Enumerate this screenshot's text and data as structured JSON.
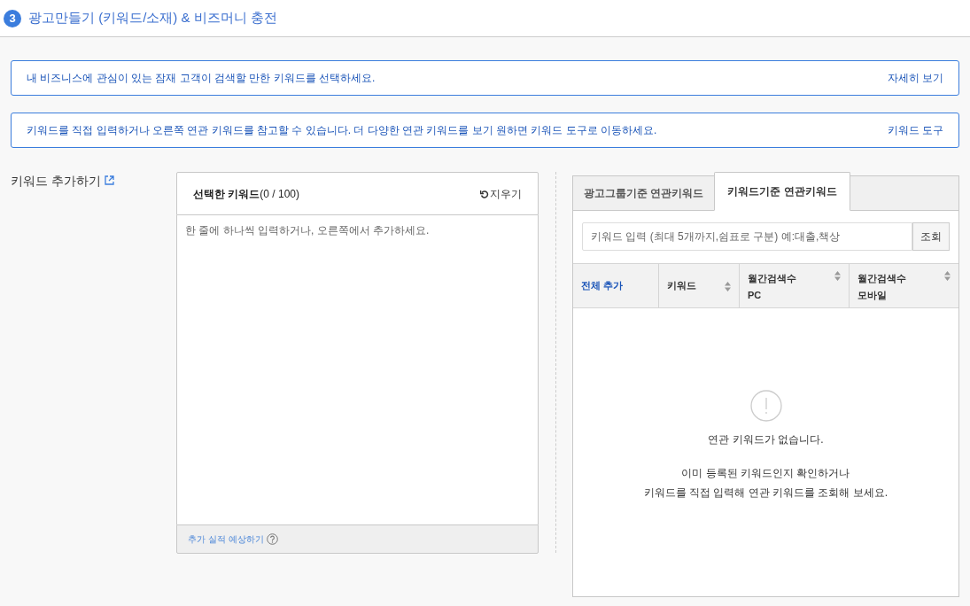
{
  "header": {
    "step": "3",
    "title": "광고만들기 (키워드/소재) & 비즈머니 충전"
  },
  "notices": [
    {
      "text": "내 비즈니스에 관심이 있는 잠재 고객이 검색할 만한 키워드를 선택하세요.",
      "link": "자세히 보기"
    },
    {
      "text": "키워드를 직접 입력하거나 오른쪽 연관 키워드를 참고할 수 있습니다. 더 다양한 연관 키워드를 보기 원하면 키워드 도구로 이동하세요.",
      "link": "키워드 도구"
    }
  ],
  "section_label": "키워드 추가하기",
  "selected_panel": {
    "title": "**선택한 키워드**(0 / 100)",
    "clear_button": "지우기",
    "placeholder": "한 줄에 하나씩 입력하거나, 오른쪽에서 추가하세요.",
    "footer_link": "추가 실적 예상하기"
  },
  "related_panel": {
    "tabs": [
      {
        "label": "광고그룹기준 연관키워드",
        "selected": false
      },
      {
        "label": "키워드기준 연관키워드",
        "selected": true
      }
    ],
    "search": {
      "placeholder": "키워드 입력 (최대 5개까지,쉼표로 구분) 예:대출,책상",
      "button": "조회"
    },
    "columns": [
      {
        "label": "전체 추가",
        "kind": "action"
      },
      {
        "label": "키워드",
        "kind": "sort"
      },
      {
        "label": "월간검색수",
        "sub": "PC",
        "kind": "sort"
      },
      {
        "label": "월간검색수",
        "sub": "모바일",
        "kind": "sort"
      }
    ],
    "empty": {
      "title": "연관 키워드가 없습니다.",
      "lines": [
        "이미 등록된 키워드인지 확인하거나",
        "키워드를 직접 입력해 연관 키워드를 조회해 보세요."
      ]
    }
  }
}
